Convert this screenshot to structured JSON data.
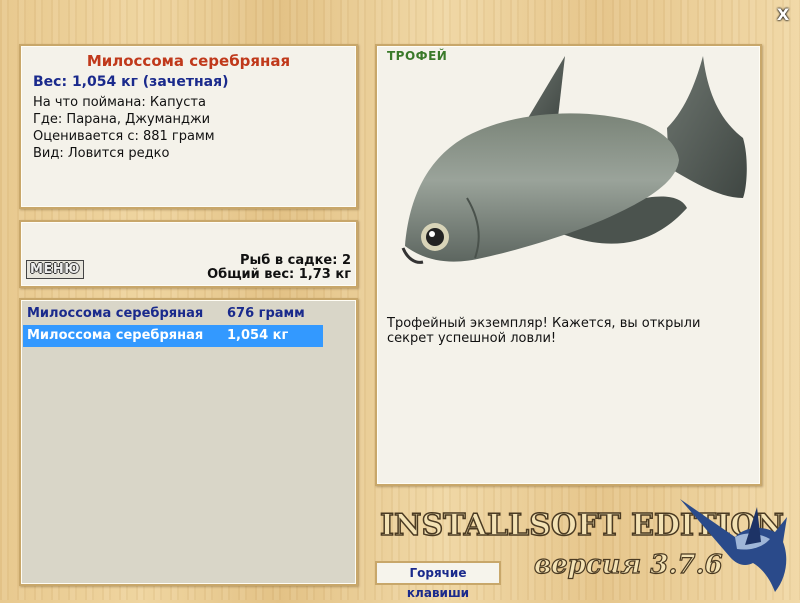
{
  "window": {
    "close_label": "X"
  },
  "info": {
    "name": "Милоссома серебряная",
    "weight": "Вес: 1,054 кг (зачетная)",
    "lines": [
      "На что поймана: Капуста",
      "Где: Парана, Джуманджи",
      "Оценивается с: 881 грамм",
      "Вид: Ловится редко"
    ]
  },
  "stats": {
    "menu_label": "МЕНЮ",
    "fish_count": "Рыб в садке: 2",
    "total_weight": "Общий вес: 1,73 кг"
  },
  "catch_list": [
    {
      "name": "Милоссома серебряная",
      "weight": "676 грамм",
      "selected": false
    },
    {
      "name": "Милоссома серебряная",
      "weight": "1,054 кг",
      "selected": true
    }
  ],
  "view": {
    "badge": "ТРОФЕЙ",
    "description": "Трофейный экземпляр! Кажется, вы открыли секрет успешной ловли!"
  },
  "footer": {
    "hotkeys_label": "Горячие клавиши",
    "brand": "INSTALLSOFT EDITION",
    "version": "версия 3.7.6"
  },
  "colors": {
    "selection": "#3399ff",
    "title": "#c0391b",
    "link": "#1a2a8c",
    "badge": "#3a7a2a"
  }
}
